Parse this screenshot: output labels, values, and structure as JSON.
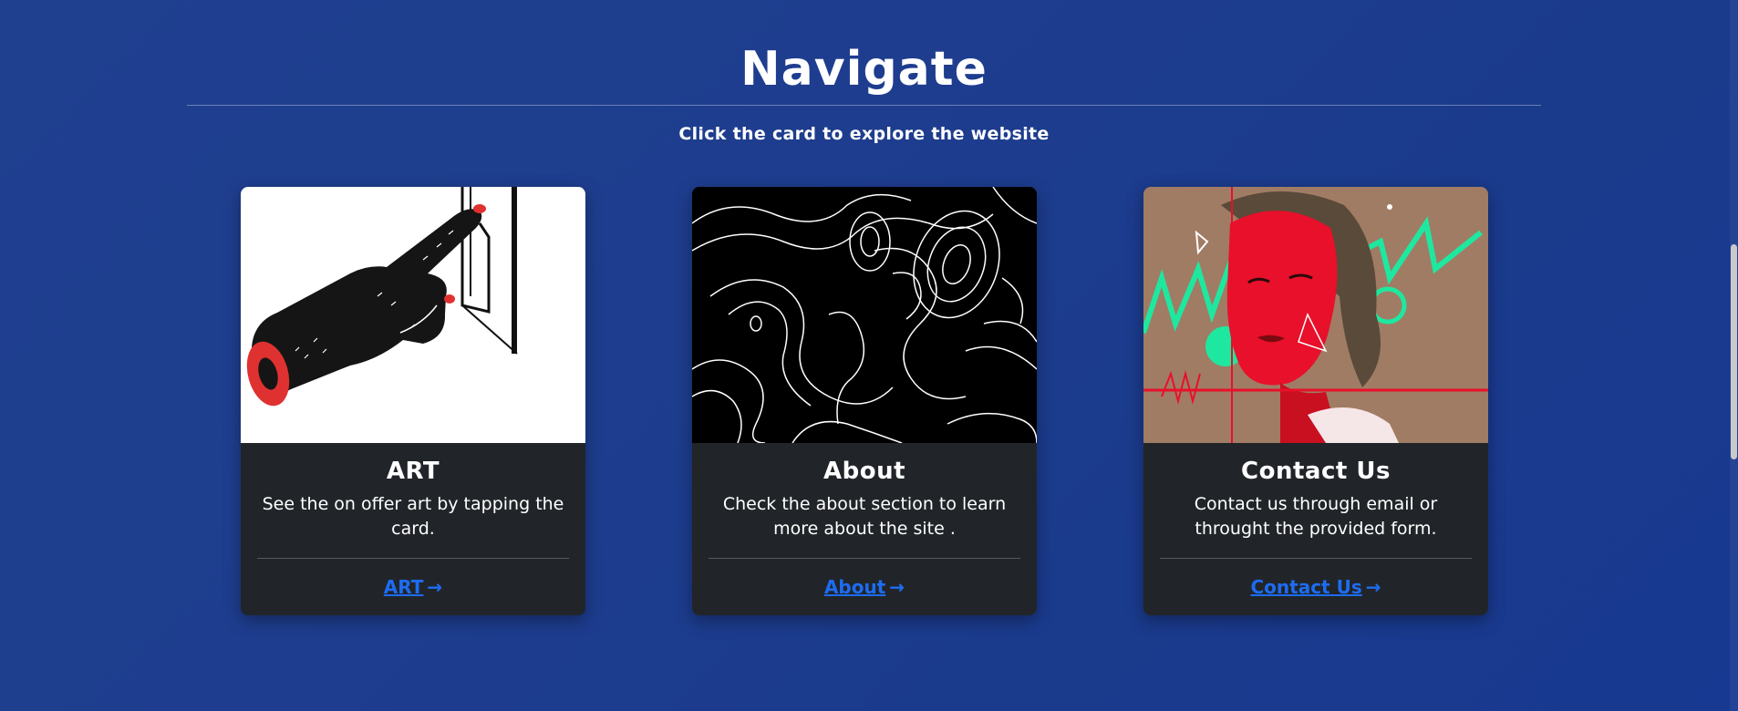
{
  "header": {
    "title": "Navigate",
    "subtitle": "Click the card to explore the website"
  },
  "cards": [
    {
      "title": "ART",
      "text": "See the on offer art by tapping the card.",
      "link": "ART",
      "image_icon": "pointing-hand-icon"
    },
    {
      "title": "About",
      "text": "Check the about section to learn more about the site .",
      "link": "About",
      "image_icon": "topographic-lines-icon"
    },
    {
      "title": "Contact Us",
      "text": "Contact us through email or throught the provided form.",
      "link": "Contact Us",
      "image_icon": "portrait-illustration-icon"
    }
  ],
  "colors": {
    "background": "#1e3d8e",
    "card": "#212529",
    "link": "#1d6cf2"
  }
}
